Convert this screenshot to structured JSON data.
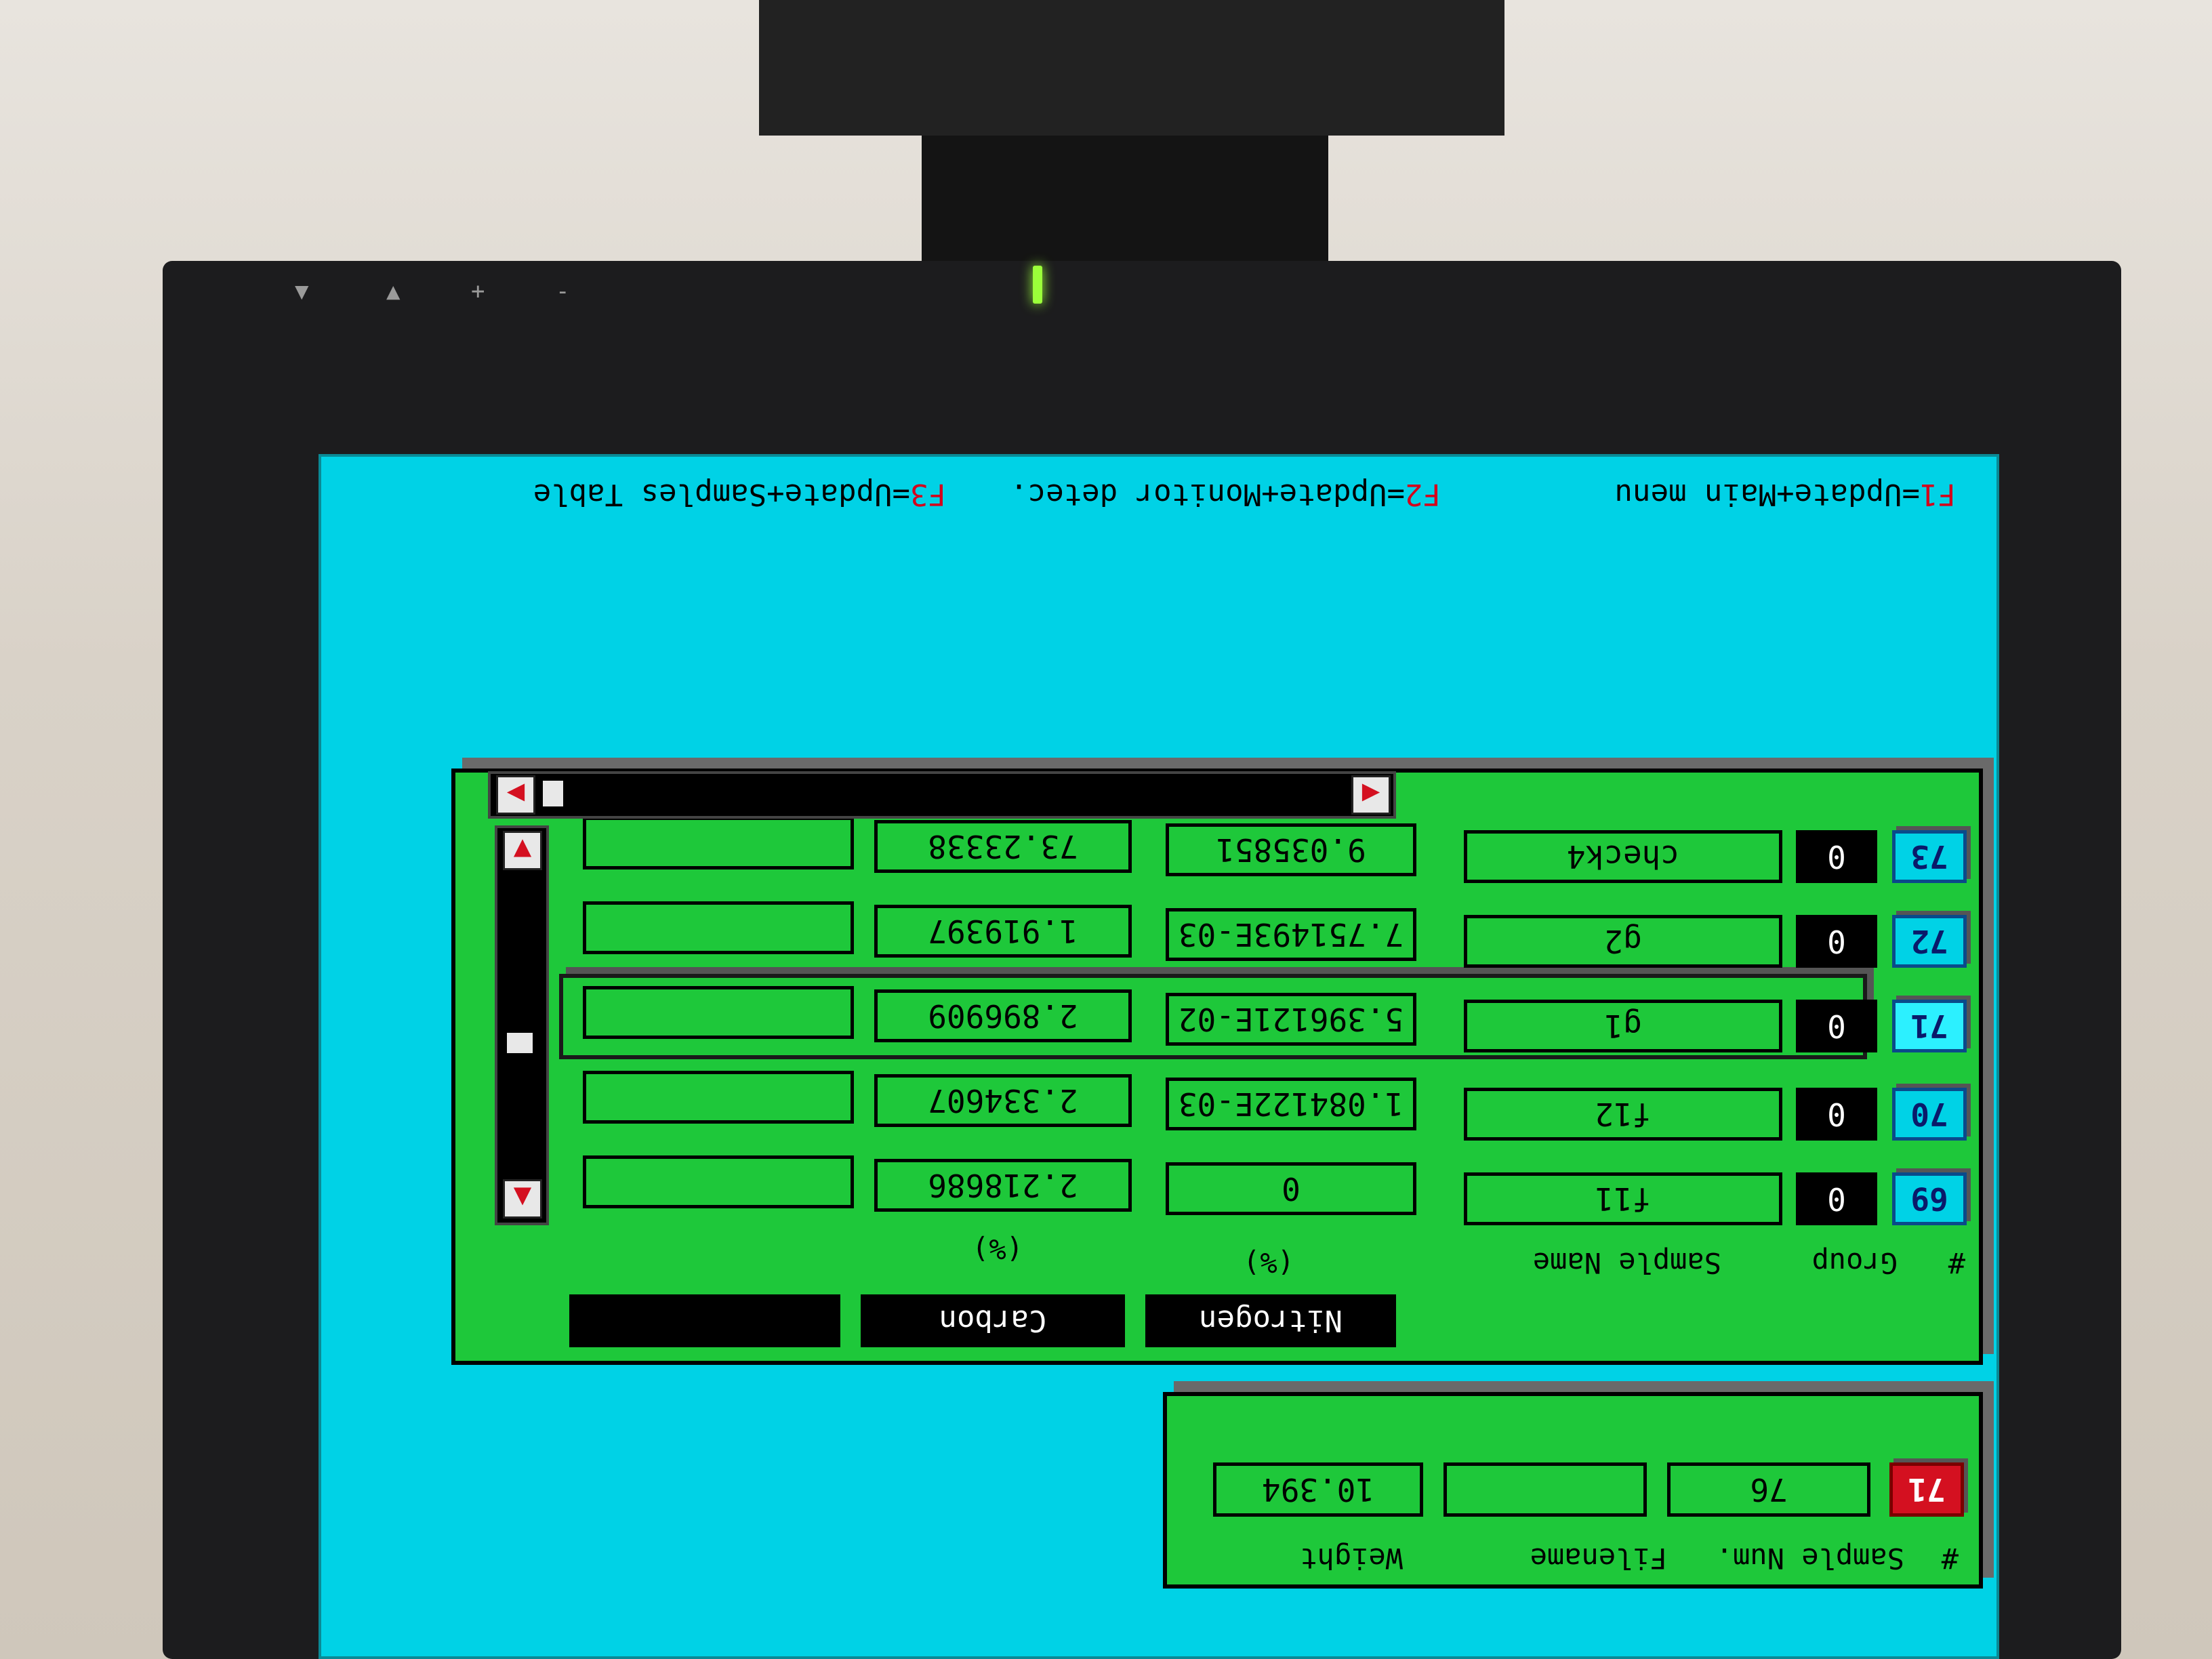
{
  "hotkeys": [
    {
      "key": "F1",
      "text": "=Update+Main menu"
    },
    {
      "key": "F2",
      "text": "=Update+Monitor detec."
    },
    {
      "key": "F3",
      "text": "=Update+Samples Table"
    }
  ],
  "current_sample": {
    "headers": [
      "#",
      "Sample Num.",
      "Filename",
      "Weight"
    ],
    "number": "71",
    "sample_num": "76",
    "filename": "",
    "weight": "10.394"
  },
  "samples_table": {
    "headers": [
      "#",
      "Group",
      "Sample Name"
    ],
    "columns": [
      {
        "label": "Nitrogen",
        "unit": "(%)"
      },
      {
        "label": "Carbon",
        "unit": "(%)"
      },
      {
        "label": "",
        "unit": ""
      }
    ],
    "rows": [
      {
        "num": "69",
        "group": "0",
        "name": "f11",
        "nitrogen": "0",
        "carbon": "2.218686",
        "extra": ""
      },
      {
        "num": "70",
        "group": "0",
        "name": "f12",
        "nitrogen": "1.084122E-03",
        "carbon": "2.334607",
        "extra": ""
      },
      {
        "num": "71",
        "group": "0",
        "name": "g1",
        "nitrogen": "5.396121E-02",
        "carbon": "2.896909",
        "extra": ""
      },
      {
        "num": "72",
        "group": "0",
        "name": "g2",
        "nitrogen": "7.751493E-03",
        "carbon": "1.919397",
        "extra": ""
      },
      {
        "num": "73",
        "group": "0",
        "name": "check4",
        "nitrogen": "9.035851",
        "carbon": "73.23338",
        "extra": ""
      }
    ],
    "selected_row": 2
  },
  "bezel": {
    "buttons": [
      "-",
      "+",
      "▲",
      "▼"
    ]
  }
}
